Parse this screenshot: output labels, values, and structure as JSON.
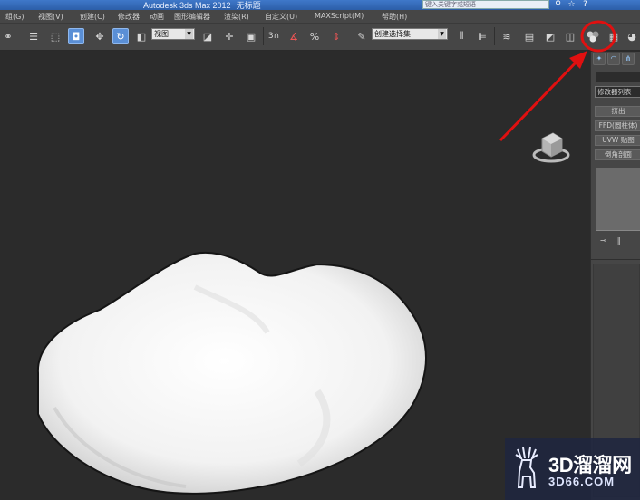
{
  "titlebar": {
    "app_title": "Autodesk 3ds Max  2012",
    "doc_title": "无标题",
    "search_placeholder": "键入关键字或短语",
    "icons": [
      "binoculars-icon",
      "star-icon",
      "help-icon"
    ]
  },
  "menu": [
    "组(G)",
    "视图(V)",
    "创建(C)",
    "修改器",
    "动画",
    "图形编辑器",
    "渲染(R)",
    "自定义(U)",
    "MAXScript(M)",
    "帮助(H)"
  ],
  "toolbar": {
    "view_dropdown": "视图",
    "selection_set_dropdown": "创建选择集",
    "snap_label": "3",
    "percent_snap_label": "%",
    "accent_color": "#5a8fd6"
  },
  "command_panel": {
    "modifier_list": "修改器列表",
    "buttons": [
      "挤出",
      "FFD(圆柱体)",
      "UVW 贴图",
      "倒角剖面"
    ]
  },
  "watermark": {
    "brand": "3D溜溜网",
    "domain": "3D66.COM"
  },
  "annotation": {
    "color": "#e01010",
    "target": "material-editor-button"
  }
}
